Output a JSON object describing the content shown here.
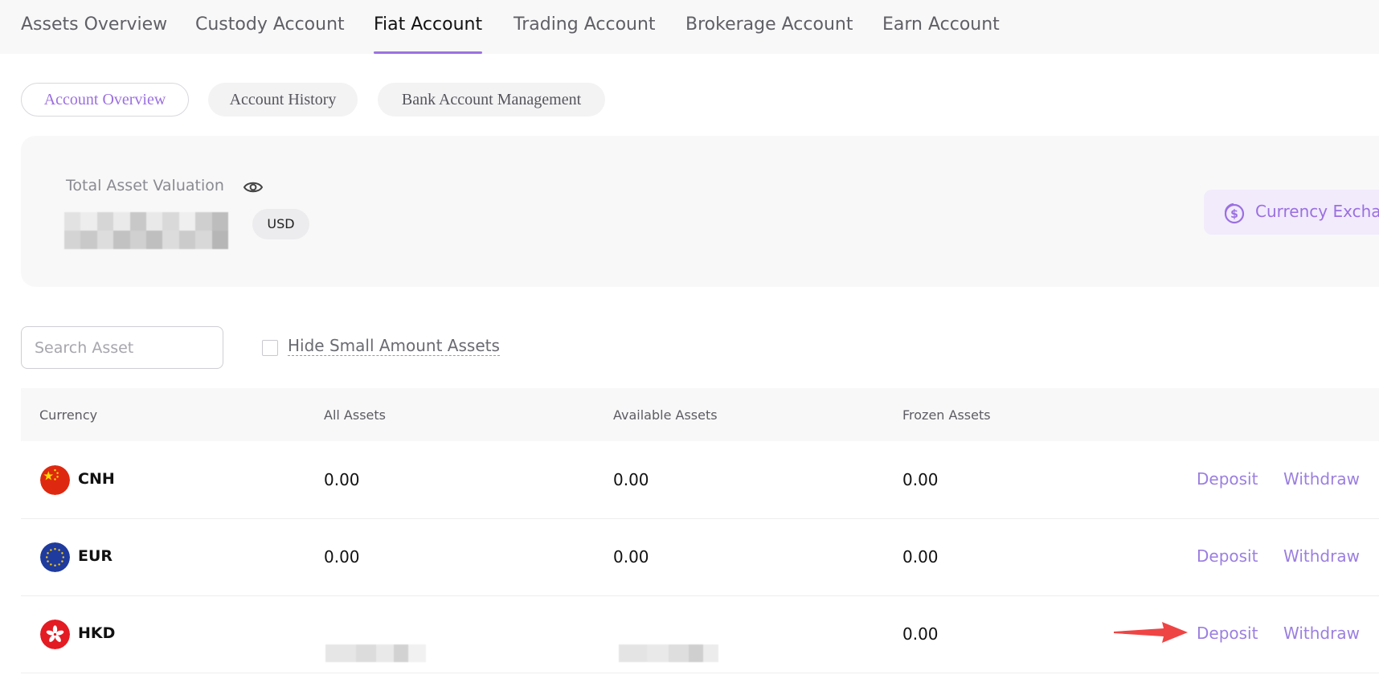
{
  "top_tabs": [
    {
      "label": "Assets Overview"
    },
    {
      "label": "Custody Account"
    },
    {
      "label": "Fiat Account",
      "active": true
    },
    {
      "label": "Trading Account"
    },
    {
      "label": "Brokerage Account"
    },
    {
      "label": "Earn Account"
    }
  ],
  "sub_tabs": [
    {
      "label": "Account Overview",
      "active": true
    },
    {
      "label": "Account History"
    },
    {
      "label": "Bank Account Management"
    }
  ],
  "summary": {
    "label": "Total Asset Valuation",
    "currency": "USD",
    "exchange_button": "Currency Exchange"
  },
  "filters": {
    "search_placeholder": "Search Asset",
    "hide_small_label": "Hide Small Amount Assets",
    "hide_small_checked": false
  },
  "table": {
    "headers": [
      "Currency",
      "All Assets",
      "Available Assets",
      "Frozen Assets"
    ],
    "rows": [
      {
        "currency": "CNH",
        "flag": "china-flag",
        "all": "0.00",
        "available": "0.00",
        "frozen": "0.00",
        "deposit": "Deposit",
        "withdraw": "Withdraw"
      },
      {
        "currency": "EUR",
        "flag": "eu-flag",
        "all": "0.00",
        "available": "0.00",
        "frozen": "0.00",
        "deposit": "Deposit",
        "withdraw": "Withdraw"
      },
      {
        "currency": "HKD",
        "flag": "hong-kong-flag",
        "all": "",
        "available": "",
        "frozen": "0.00",
        "deposit": "Deposit",
        "withdraw": "Withdraw"
      }
    ]
  },
  "colors": {
    "accent": "#9b6fe0",
    "annotation_arrow": "#ef4444"
  }
}
